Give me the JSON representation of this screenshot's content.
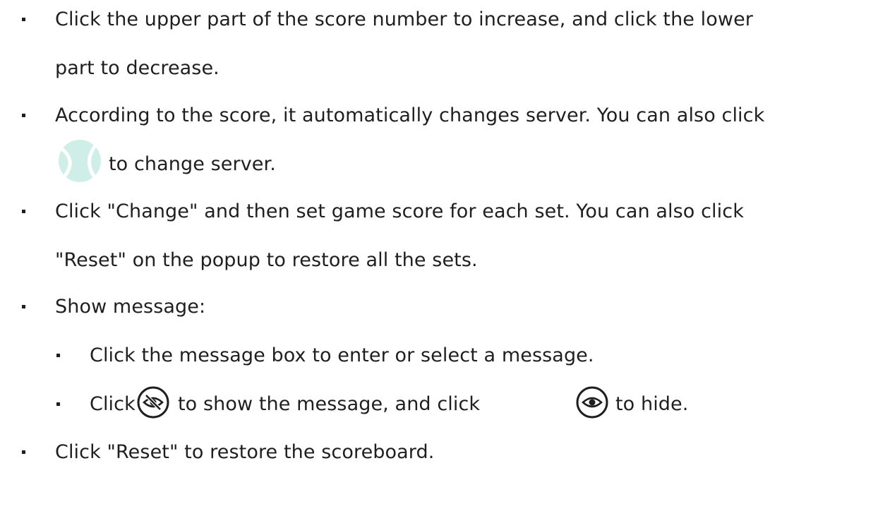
{
  "instructions": {
    "item1": {
      "line1": "Click the upper part of the score number to increase, and click the lower",
      "line2": "part to decrease."
    },
    "item2": {
      "line1": "According to the score, it automatically changes server. You can also click",
      "line2_after_icon": "to change server.",
      "icon": "tennis-ball-icon"
    },
    "item3": {
      "line1": "Click \"Change\" and then set game score for each set. You can also click",
      "line2": "\"Reset\" on the popup to restore all the sets."
    },
    "item4": {
      "label": "Show message:",
      "sub1": "Click the message box to enter or select a message.",
      "sub2": {
        "prefix": "Click",
        "middle": "to show the message, and click",
        "suffix": "to hide.",
        "show_icon": "eye-slash-icon",
        "hide_icon": "eye-icon"
      }
    },
    "item5": {
      "line1": "Click \"Reset\" to restore the scoreboard."
    }
  },
  "colors": {
    "text": "#1f1f1f",
    "tennis_ball": "#cfeee8",
    "icon_stroke": "#1f1f1f"
  }
}
